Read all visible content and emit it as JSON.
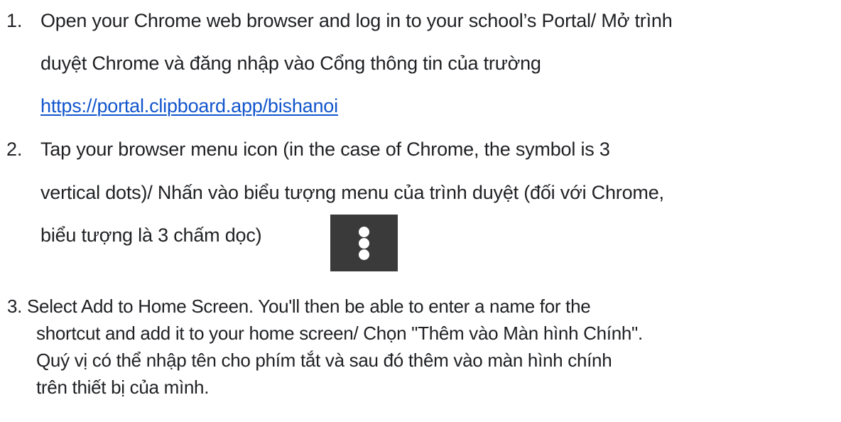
{
  "steps": [
    {
      "number": "1.",
      "lines": [
        "Open your Chrome web browser and log in to your school’s Portal/ Mở trình",
        "duyệt Chrome và đăng nhập vào Cổng thông tin của trường"
      ],
      "link": "https://portal.clipboard.app/bishanoi"
    },
    {
      "number": "2.",
      "lines": [
        "Tap your browser menu icon (in the case of Chrome, the symbol is 3",
        "vertical dots)/ Nhấn vào biểu tượng menu của trình duyệt (đối với Chrome,",
        "biểu tượng là 3 chấm dọc)"
      ],
      "icon": "three-vertical-dots-menu-icon"
    },
    {
      "lines": [
        "3. Select Add to Home Screen. You'll then be able to enter a name for the",
        "shortcut and add it to your home screen/ Chọn \"Thêm vào Màn hình Chính\".",
        "Quý vị có thể nhập tên cho phím tắt và sau đó thêm vào màn hình chính",
        "trên thiết bị của mình."
      ]
    }
  ],
  "colors": {
    "text": "#202124",
    "link": "#1155cc",
    "icon_background": "#3a3a3a",
    "icon_dots": "#ffffff"
  }
}
